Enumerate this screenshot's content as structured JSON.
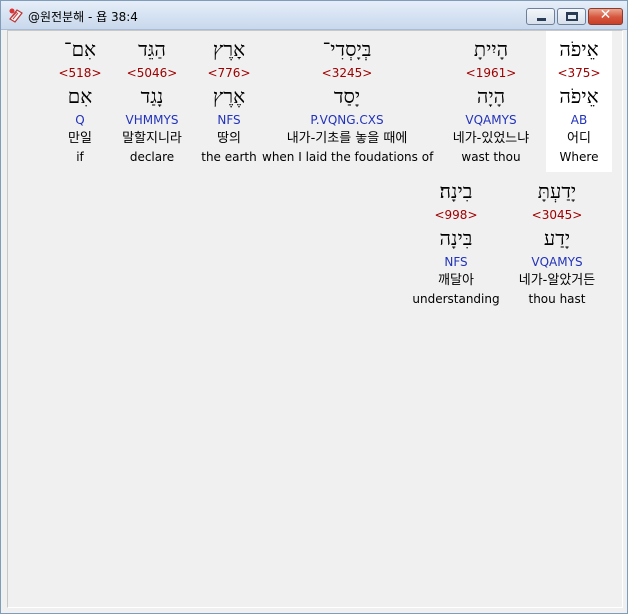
{
  "window": {
    "title": "@원전분해 - 욥 38:4",
    "icon": "book-icon",
    "controls": {
      "minimize": "minimize-icon",
      "maximize": "maximize-icon",
      "close": "close-icon",
      "close_glyph": "✕"
    }
  },
  "rows": [
    {
      "words": [
        {
          "hebrew": "אֵיפֹה",
          "strong": "<375>",
          "lemma": "אֵיפֹה",
          "parsing": "AB",
          "korean": "어디",
          "english": "Where",
          "selected": true
        },
        {
          "hebrew": "הָיִיתָ",
          "strong": "<1961>",
          "lemma": "הָיָה",
          "parsing": "VQAMYS",
          "korean": "네가-있었느냐",
          "english": "wast thou"
        },
        {
          "hebrew": "בְּיָסְדִי־",
          "strong": "<3245>",
          "lemma": "יָסַד",
          "parsing": "P.VQNG.CXS",
          "korean": "내가-기초를 놓을 때에",
          "english": "when I laid the foudations of"
        },
        {
          "hebrew": "אָרֶץ",
          "strong": "<776>",
          "lemma": "אֶרֶץ",
          "parsing": "NFS",
          "korean": "땅의",
          "english": "the earth"
        },
        {
          "hebrew": "הַגֵּד",
          "strong": "<5046>",
          "lemma": "נָגַד",
          "parsing": "VHMMYS",
          "korean": "말할지니라",
          "english": "declare"
        },
        {
          "hebrew": "אִם־",
          "strong": "<518>",
          "lemma": "אִם",
          "parsing": "Q",
          "korean": "만일",
          "english": "if"
        }
      ]
    },
    {
      "words": [
        {
          "hebrew": "יָדַעְתָּ",
          "strong": "<3045>",
          "lemma": "יָדַע",
          "parsing": "VQAMYS",
          "korean": "네가-알았거든",
          "english": "thou hast"
        },
        {
          "hebrew": "בִינָה׃",
          "strong": "<998>",
          "lemma": "בִּינָה",
          "parsing": "NFS",
          "korean": "깨달아",
          "english": "understanding"
        }
      ]
    }
  ]
}
